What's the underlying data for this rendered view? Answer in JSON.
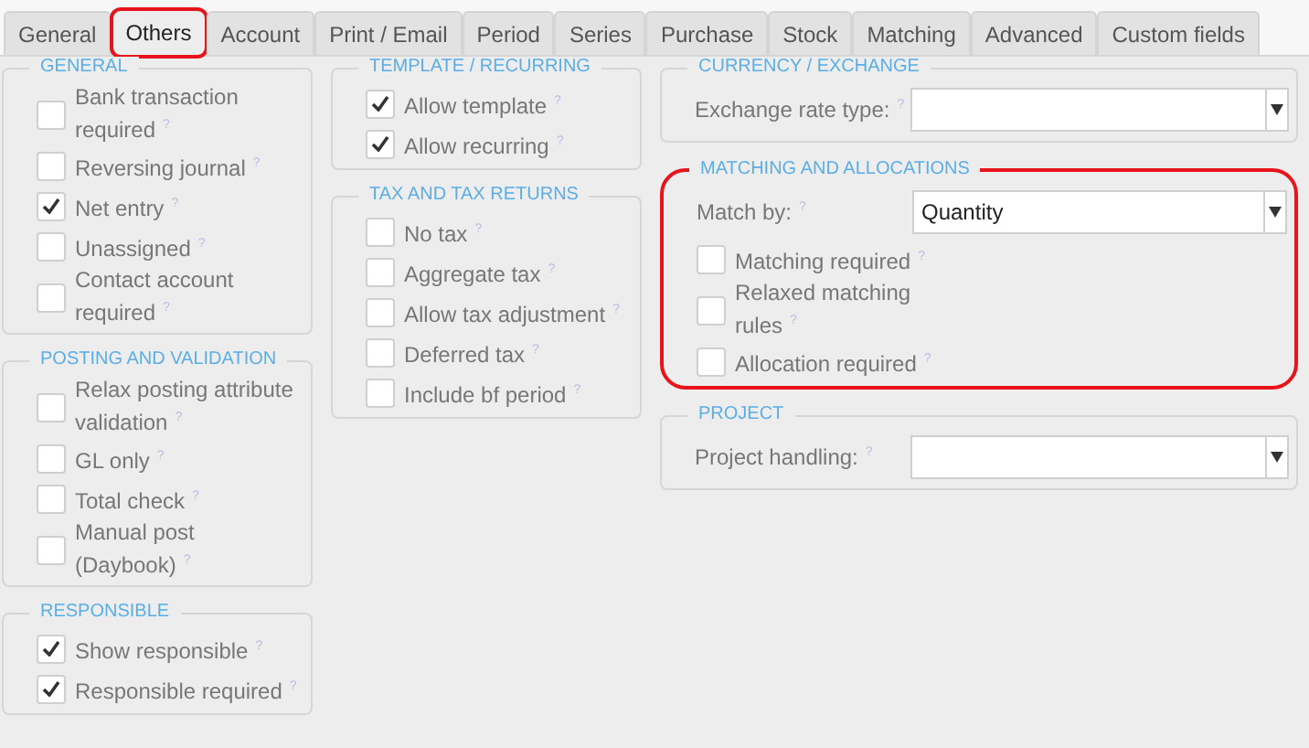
{
  "tabs": [
    {
      "label": "General",
      "selected": false,
      "highlighted": false
    },
    {
      "label": "Others",
      "selected": true,
      "highlighted": true
    },
    {
      "label": "Account",
      "selected": false,
      "highlighted": false
    },
    {
      "label": "Print / Email",
      "selected": false,
      "highlighted": false
    },
    {
      "label": "Period",
      "selected": false,
      "highlighted": false
    },
    {
      "label": "Series",
      "selected": false,
      "highlighted": false
    },
    {
      "label": "Purchase",
      "selected": false,
      "highlighted": false
    },
    {
      "label": "Stock",
      "selected": false,
      "highlighted": false
    },
    {
      "label": "Matching",
      "selected": false,
      "highlighted": false
    },
    {
      "label": "Advanced",
      "selected": false,
      "highlighted": false
    },
    {
      "label": "Custom fields",
      "selected": false,
      "highlighted": false
    }
  ],
  "columns": [
    [
      {
        "title": "GENERAL",
        "highlighted": false,
        "fields": [
          {
            "kind": "checkbox",
            "label": "Bank transaction required",
            "help": "?",
            "checked": false
          },
          {
            "kind": "checkbox",
            "label": "Reversing journal",
            "help": "?",
            "checked": false
          },
          {
            "kind": "checkbox",
            "label": "Net entry",
            "help": "?",
            "checked": true
          },
          {
            "kind": "checkbox",
            "label": "Unassigned",
            "help": "?",
            "checked": false
          },
          {
            "kind": "checkbox",
            "label": "Contact account required",
            "help": "?",
            "checked": false
          }
        ]
      },
      {
        "title": "POSTING AND VALIDATION",
        "highlighted": false,
        "fields": [
          {
            "kind": "checkbox",
            "label": "Relax posting attribute validation",
            "help": "?",
            "checked": false
          },
          {
            "kind": "checkbox",
            "label": "GL only",
            "help": "?",
            "checked": false
          },
          {
            "kind": "checkbox",
            "label": "Total check",
            "help": "?",
            "checked": false
          },
          {
            "kind": "checkbox",
            "label": "Manual post (Daybook)",
            "help": "?",
            "checked": false
          }
        ]
      },
      {
        "title": "RESPONSIBLE",
        "highlighted": false,
        "fields": [
          {
            "kind": "checkbox",
            "label": "Show responsible",
            "help": "?",
            "checked": true
          },
          {
            "kind": "checkbox",
            "label": "Responsible required",
            "help": "?",
            "checked": true
          }
        ]
      }
    ],
    [
      {
        "title": "TEMPLATE / RECURRING",
        "highlighted": false,
        "fields": [
          {
            "kind": "checkbox",
            "label": "Allow template",
            "help": "?",
            "checked": true
          },
          {
            "kind": "checkbox",
            "label": "Allow recurring",
            "help": "?",
            "checked": true
          }
        ]
      },
      {
        "title": "TAX AND TAX RETURNS",
        "highlighted": false,
        "fields": [
          {
            "kind": "checkbox",
            "label": "No tax",
            "help": "?",
            "checked": false
          },
          {
            "kind": "checkbox",
            "label": "Aggregate tax",
            "help": "?",
            "checked": false
          },
          {
            "kind": "checkbox",
            "label": "Allow tax adjustment",
            "help": "?",
            "checked": false
          },
          {
            "kind": "checkbox",
            "label": "Deferred tax",
            "help": "?",
            "checked": false
          },
          {
            "kind": "checkbox",
            "label": "Include bf period",
            "help": "?",
            "checked": false
          }
        ]
      }
    ],
    [
      {
        "title": "CURRENCY / EXCHANGE",
        "highlighted": false,
        "fields": [
          {
            "kind": "select",
            "label": "Exchange rate type:",
            "help": "?"
          }
        ]
      },
      {
        "title": "MATCHING AND ALLOCATIONS",
        "highlighted": true,
        "fields": [
          {
            "kind": "select",
            "label": "Match by:",
            "help": "?",
            "value": "Quantity"
          },
          {
            "kind": "checkbox",
            "label": "Matching required",
            "help": "?",
            "checked": false
          },
          {
            "kind": "checkbox",
            "label": "Relaxed matching rules",
            "help": "?",
            "checked": false
          },
          {
            "kind": "checkbox",
            "label": "Allocation required",
            "help": "?",
            "checked": false
          }
        ]
      },
      {
        "title": "PROJECT",
        "highlighted": false,
        "fields": [
          {
            "kind": "select",
            "label": "Project handling:",
            "help": "?"
          }
        ]
      }
    ]
  ]
}
